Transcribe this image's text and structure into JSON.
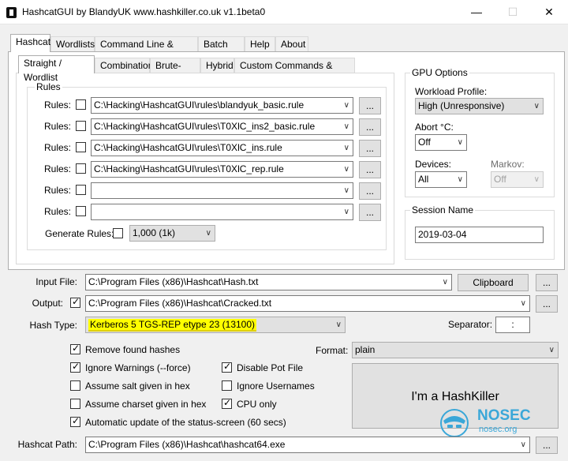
{
  "window": {
    "title": "HashcatGUI by BlandyUK www.hashkiller.co.uk v1.1beta0",
    "minimize": "—",
    "maximize": "☐",
    "close": "✕"
  },
  "main_tabs": [
    "Hashcat",
    "Wordlists",
    "Command Line & Markov",
    "Batch Job",
    "Help",
    "About"
  ],
  "attack_tabs": [
    "Straight / Wordlist",
    "Combination",
    "Brute-force",
    "Hybrid",
    "Custom Commands & Sessions"
  ],
  "rules": {
    "legend": "Rules",
    "row_label": "Rules:",
    "browse_label": "...",
    "rows": [
      {
        "checked": false,
        "value": "C:\\Hacking\\HashcatGUI\\rules\\blandyuk_basic.rule"
      },
      {
        "checked": false,
        "value": "C:\\Hacking\\HashcatGUI\\rules\\T0XlC_ins2_basic.rule"
      },
      {
        "checked": false,
        "value": "C:\\Hacking\\HashcatGUI\\rules\\T0XlC_ins.rule"
      },
      {
        "checked": false,
        "value": "C:\\Hacking\\HashcatGUI\\rules\\T0XlC_rep.rule"
      },
      {
        "checked": false,
        "value": ""
      },
      {
        "checked": false,
        "value": ""
      }
    ],
    "generate_label": "Generate Rules:",
    "generate_value": "1,000 (1k)"
  },
  "gpu": {
    "legend": "GPU Options",
    "workload_label": "Workload Profile:",
    "workload_value": "High (Unresponsive)",
    "abort_label": "Abort °C:",
    "abort_value": "Off",
    "devices_label": "Devices:",
    "devices_value": "All",
    "markov_label": "Markov:",
    "markov_value": "Off"
  },
  "session": {
    "legend": "Session Name",
    "value": "2019-03-04"
  },
  "io": {
    "input_label": "Input File:",
    "input_value": "C:\\Program Files (x86)\\Hashcat\\Hash.txt",
    "clipboard_label": "Clipboard",
    "output_label": "Output:",
    "output_value": "C:\\Program Files (x86)\\Hashcat\\Cracked.txt",
    "hash_type_label": "Hash Type:",
    "hash_type_value": "Kerberos 5 TGS-REP etype 23 (13100)",
    "separator_label": "Separator:",
    "separator_value": ":",
    "browse_label": "..."
  },
  "options": {
    "remove_found": "Remove found hashes",
    "ignore_warnings": "Ignore Warnings (--force)",
    "disable_pot": "Disable Pot File",
    "assume_salt_hex": "Assume salt given in hex",
    "ignore_usernames": "Ignore Usernames",
    "assume_charset_hex": "Assume charset given in hex",
    "cpu_only": "CPU only",
    "auto_update": "Automatic update of the status-screen (60 secs)",
    "format_label": "Format:",
    "format_value": "plain"
  },
  "hashkiller_button": "I'm a HashKiller",
  "watermark": {
    "brand": "NOSEC",
    "site": "nosec.org"
  },
  "hashcat_path": {
    "label": "Hashcat Path:",
    "value": "C:\\Program Files (x86)\\Hashcat\\hashcat64.exe"
  }
}
